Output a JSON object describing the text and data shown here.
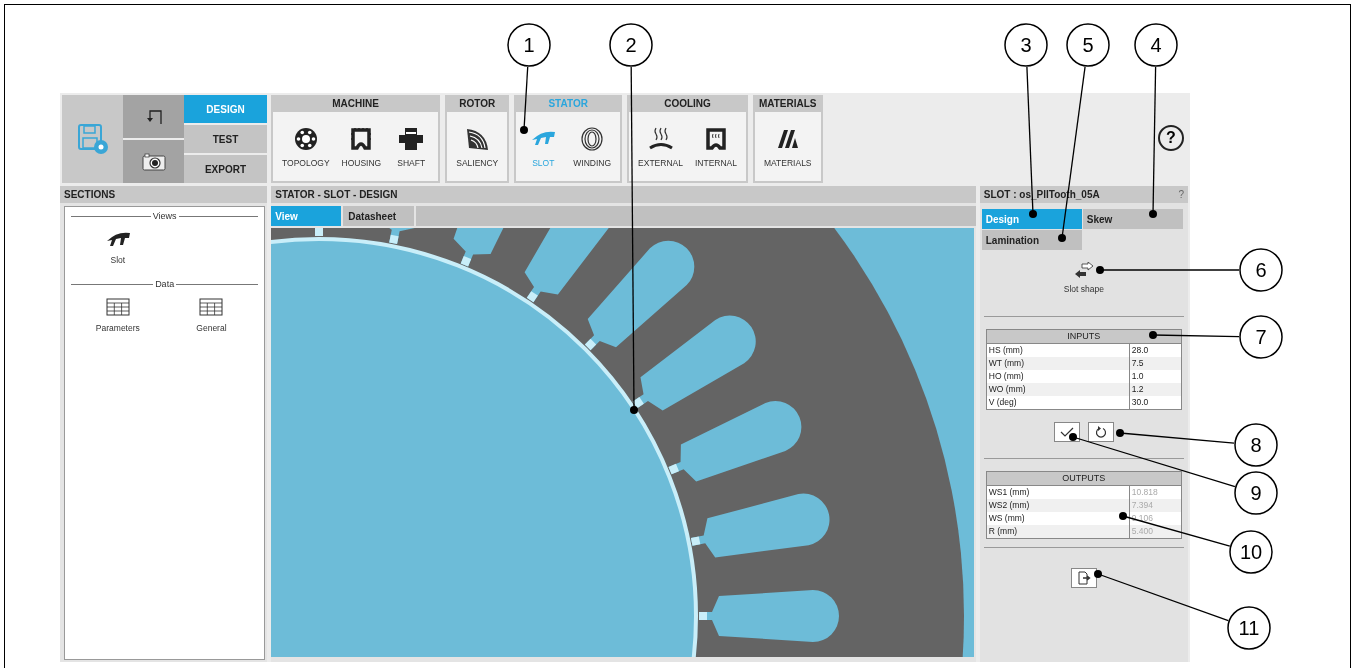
{
  "toolbar": {
    "modes": [
      {
        "label": "DESIGN",
        "selected": true
      },
      {
        "label": "TEST",
        "selected": false
      },
      {
        "label": "EXPORT",
        "selected": false
      }
    ],
    "groups": [
      {
        "title": "MACHINE",
        "selected": false,
        "items": [
          {
            "label": "TOPOLOGY",
            "kind": "topology",
            "selected": false
          },
          {
            "label": "HOUSING",
            "kind": "housing",
            "selected": false
          },
          {
            "label": "SHAFT",
            "kind": "shaft",
            "selected": false
          }
        ]
      },
      {
        "title": "ROTOR",
        "selected": false,
        "items": [
          {
            "label": "SALIENCY",
            "kind": "saliency",
            "selected": false
          }
        ]
      },
      {
        "title": "STATOR",
        "selected": true,
        "items": [
          {
            "label": "SLOT",
            "kind": "slot",
            "selected": true
          },
          {
            "label": "WINDING",
            "kind": "winding",
            "selected": false
          }
        ]
      },
      {
        "title": "COOLING",
        "selected": false,
        "items": [
          {
            "label": "EXTERNAL",
            "kind": "external",
            "selected": false
          },
          {
            "label": "INTERNAL",
            "kind": "internal",
            "selected": false
          }
        ]
      },
      {
        "title": "MATERIALS",
        "selected": false,
        "items": [
          {
            "label": "MATERIALS",
            "kind": "materials",
            "selected": false
          }
        ]
      }
    ],
    "help": "?"
  },
  "sections": {
    "title": "SECTIONS",
    "groups": [
      {
        "title": "Views",
        "items": [
          {
            "label": "Slot",
            "kind": "slot"
          }
        ]
      },
      {
        "title": "Data",
        "items": [
          {
            "label": "Parameters",
            "kind": "table"
          },
          {
            "label": "General",
            "kind": "table"
          }
        ]
      }
    ]
  },
  "main": {
    "title": "STATOR - SLOT - DESIGN",
    "tabs": [
      {
        "label": "View",
        "selected": true
      },
      {
        "label": "Datasheet",
        "selected": false
      }
    ]
  },
  "panel": {
    "title": "SLOT : os_PllTooth_05A",
    "help": "?",
    "tabs": [
      {
        "label": "Design",
        "selected": true
      },
      {
        "label": "Skew",
        "selected": false
      },
      {
        "label": "Lamination",
        "selected": false
      }
    ],
    "shape_button": "Slot shape",
    "inputs": {
      "title": "INPUTS",
      "rows": [
        {
          "name": "HS (mm)",
          "value": "28.0"
        },
        {
          "name": "WT (mm)",
          "value": "7.5"
        },
        {
          "name": "HO (mm)",
          "value": "1.0"
        },
        {
          "name": "WO (mm)",
          "value": "1.2"
        },
        {
          "name": "V (deg)",
          "value": "30.0"
        }
      ]
    },
    "outputs": {
      "title": "OUTPUTS",
      "rows": [
        {
          "name": "WS1 (mm)",
          "value": "10.818"
        },
        {
          "name": "WS2 (mm)",
          "value": "7.394"
        },
        {
          "name": "WS (mm)",
          "value": "9.106"
        },
        {
          "name": "R (mm)",
          "value": "5.400"
        }
      ]
    }
  },
  "callouts": [
    "1",
    "2",
    "3",
    "5",
    "4",
    "6",
    "7",
    "8",
    "9",
    "10",
    "11"
  ]
}
